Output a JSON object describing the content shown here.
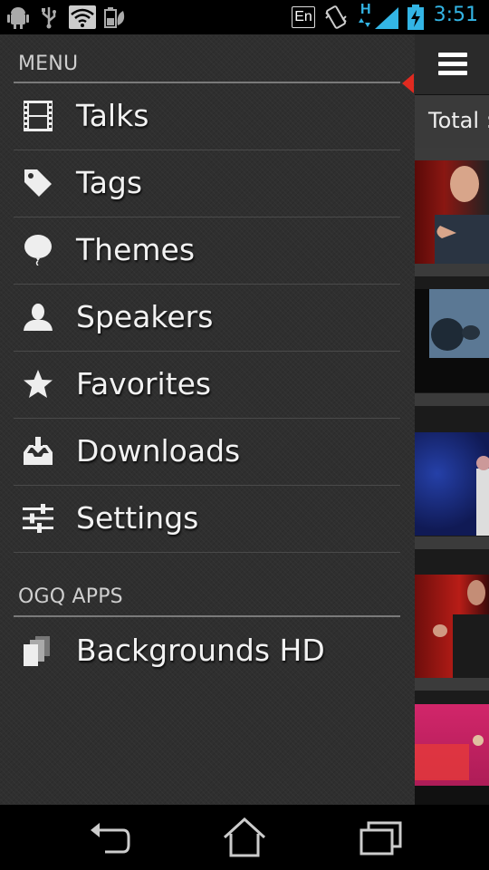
{
  "status_bar": {
    "language": "En",
    "network_type": "H",
    "time": "3:51",
    "icons": [
      "android-debug-icon",
      "usb-icon",
      "wifi-icon",
      "battery-saver-icon",
      "vibrate-icon",
      "signal-icon",
      "battery-charging-icon"
    ]
  },
  "drawer": {
    "menu_header": "MENU",
    "items": [
      {
        "label": "Talks",
        "icon": "film-icon",
        "selected": true
      },
      {
        "label": "Tags",
        "icon": "tag-icon",
        "selected": false
      },
      {
        "label": "Themes",
        "icon": "balloon-icon",
        "selected": false
      },
      {
        "label": "Speakers",
        "icon": "person-icon",
        "selected": false
      },
      {
        "label": "Favorites",
        "icon": "star-icon",
        "selected": false
      },
      {
        "label": "Downloads",
        "icon": "download-tray-icon",
        "selected": false
      },
      {
        "label": "Settings",
        "icon": "sliders-icon",
        "selected": false
      }
    ],
    "apps_header": "OGQ APPS",
    "apps": [
      {
        "label": "Backgrounds HD",
        "icon": "stacked-pages-icon"
      }
    ]
  },
  "content": {
    "menu_icon": "hamburger-icon",
    "total_label": "Total :",
    "thumbnails": [
      "talk-thumbnail-1",
      "talk-thumbnail-2",
      "talk-thumbnail-3",
      "talk-thumbnail-4",
      "talk-thumbnail-5"
    ]
  },
  "nav_bar": {
    "icons": [
      "back-icon",
      "home-icon",
      "recent-apps-icon"
    ]
  },
  "colors": {
    "accent": "#33b5e5",
    "selected_marker": "#e02a20",
    "drawer_bg": "#2f2f2f"
  }
}
